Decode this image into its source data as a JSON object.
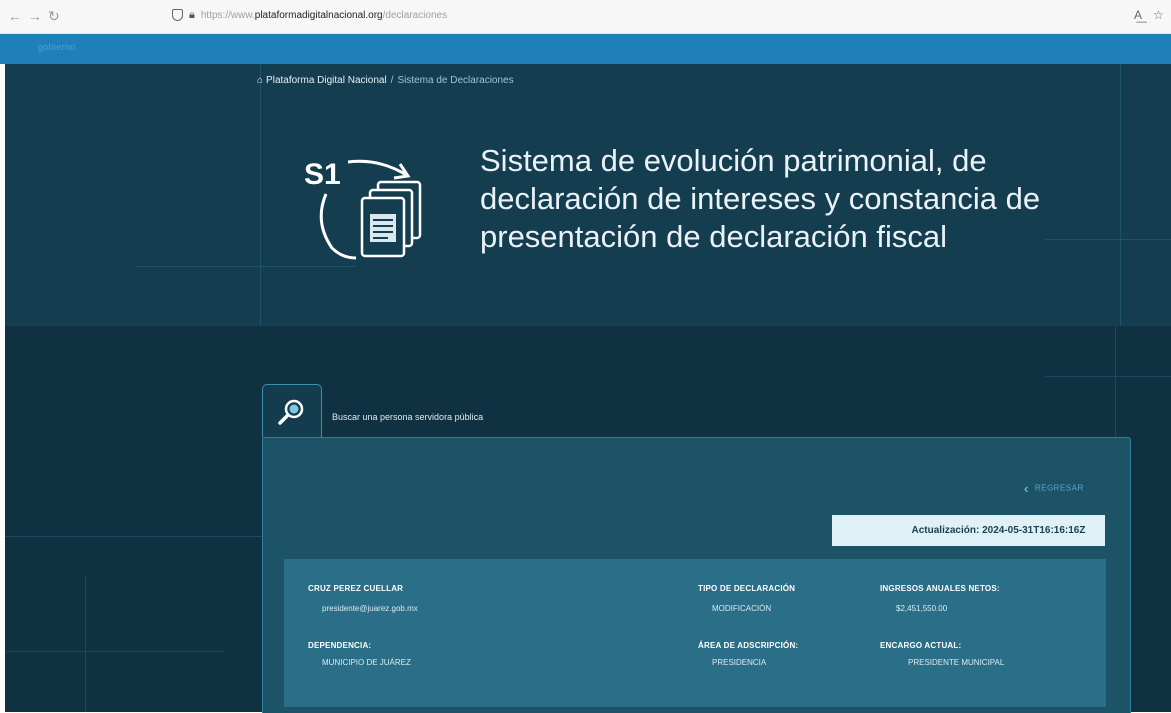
{
  "browser": {
    "url_scheme": "https://www.",
    "url_host": "plataformadigitalnacional.org",
    "url_path": "/declaraciones"
  },
  "topbar": {
    "text": "gobierno"
  },
  "breadcrumb": {
    "home": "Plataforma Digital Nacional",
    "separator": "/",
    "current": "Sistema de Declaraciones"
  },
  "hero": {
    "icon_code": "S1",
    "title": "Sistema de evolución patrimonial, de declaración de intereses y constancia de presentación de declaración fiscal"
  },
  "search_tab": {
    "label": "Buscar una persona servidora pública"
  },
  "panel": {
    "back_label": "REGRESAR",
    "update_label": "Actualización: 2024-05-31T16:16:16Z"
  },
  "person": {
    "name": "CRUZ PEREZ CUELLAR",
    "email": "presidente@juarez.gob.mx",
    "dependencia_label": "DEPENDENCIA:",
    "dependencia_value": "MUNICIPIO DE JUÁREZ",
    "tipo_label": "TIPO DE DECLARACIÓN",
    "tipo_value": "MODIFICACIÓN",
    "area_label": "ÁREA DE ADSCRIPCIÓN:",
    "area_value": "PRESIDENCIA",
    "ingresos_label": "INGRESOS ANUALES NETOS:",
    "ingresos_value": "$2,451,550.00",
    "encargo_label": "ENCARGO ACTUAL:",
    "encargo_value": "PRESIDENTE MUNICIPAL"
  }
}
